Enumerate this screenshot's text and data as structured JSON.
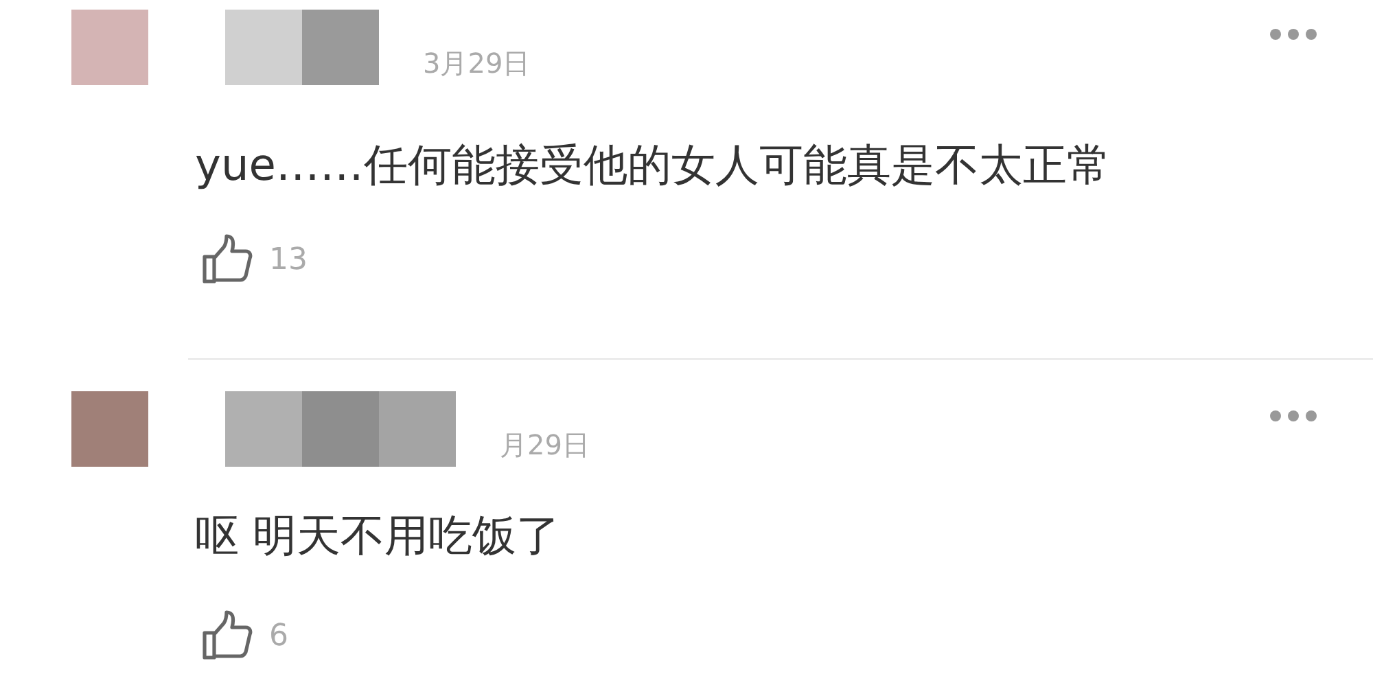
{
  "comments": [
    {
      "avatar": {
        "color": "#d4b4b4"
      },
      "name_blocks": [
        {
          "color": "#d0d0d0"
        },
        {
          "color": "#9a9a9a"
        }
      ],
      "date": "3月29日",
      "text": "yue……任何能接受他的女人可能真是不太正常",
      "likes": "13"
    },
    {
      "avatar": {
        "color": "#a08078"
      },
      "name_blocks": [
        {
          "color": "#b0b0b0"
        },
        {
          "color": "#8e8e8e"
        },
        {
          "color": "#a4a4a4"
        }
      ],
      "date": "月29日",
      "text": "呕 明天不用吃饭了",
      "likes": "6"
    }
  ]
}
